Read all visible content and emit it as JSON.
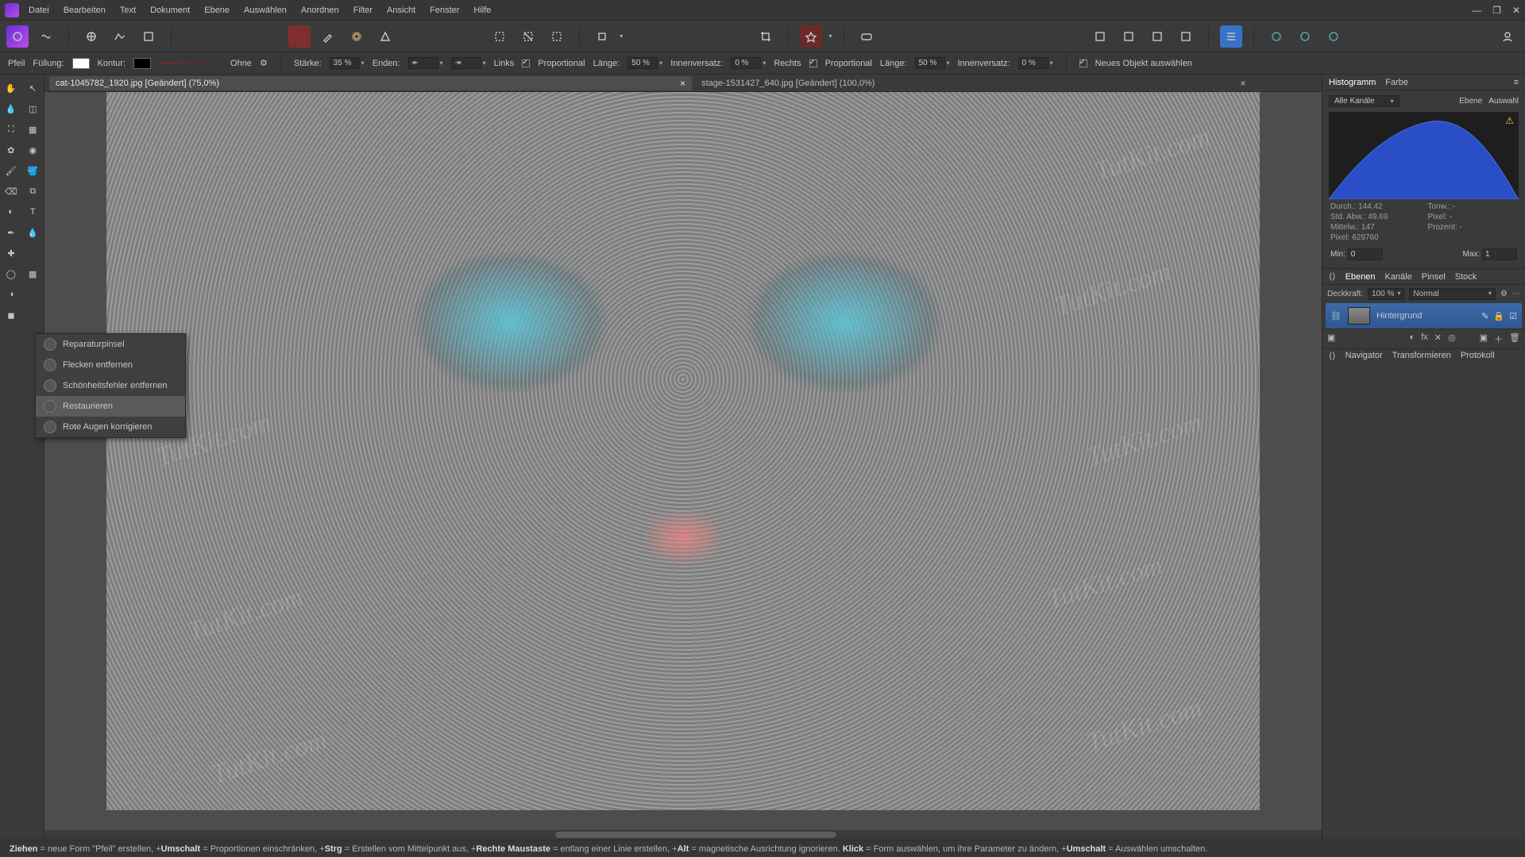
{
  "menubar": [
    "Datei",
    "Bearbeiten",
    "Text",
    "Dokument",
    "Ebene",
    "Auswählen",
    "Anordnen",
    "Filter",
    "Ansicht",
    "Fenster",
    "Hilfe"
  ],
  "context": {
    "tool": "Pfeil",
    "fill": "Füllung:",
    "stroke_label": "Kontur:",
    "style_label": "Ohne",
    "strength_label": "Stärke:",
    "strength": "35 %",
    "ends_label": "Enden:",
    "links_label": "Links",
    "proportional": "Proportional",
    "length_label": "Länge:",
    "length_l": "50 %",
    "inset_label": "Innenversatz:",
    "inset_l": "0 %",
    "rechts_label": "Rechts",
    "length_r": "50 %",
    "inset_r": "0 %",
    "new_obj": "Neues Objekt auswählen"
  },
  "tabs": [
    {
      "title": "cat-1045782_1920.jpg [Geändert] (75,0%)",
      "active": true
    },
    {
      "title": "stage-1531427_640.jpg [Geändert] (100,0%)",
      "active": false
    }
  ],
  "flyout": {
    "items": [
      {
        "label": "Reparaturpinsel"
      },
      {
        "label": "Flecken entfernen"
      },
      {
        "label": "Schönheitsfehler entfernen"
      },
      {
        "label": "Restaurieren",
        "hl": true
      },
      {
        "label": "Rote Augen korrigieren"
      }
    ]
  },
  "watermark": "TutKit.com",
  "right": {
    "tabs1": [
      "Histogramm",
      "Farbe"
    ],
    "channel_label": "Alle Kanäle",
    "ebene": "Ebene",
    "auswahl": "Auswahl",
    "stats": {
      "durch": "Durch.: 144.42",
      "stdabw": "Std. Abw.: 49.69",
      "mittelw": "Mittelw.: 147",
      "pixel": "Pixel: 629760",
      "tonw": "Tonw.: -",
      "pixel2": "Pixel: -",
      "prozent": "Prozent: -"
    },
    "min_label": "Min:",
    "min": "0",
    "max_label": "Max:",
    "max": "1",
    "tabs2": [
      "Ebenen",
      "Kanäle",
      "Pinsel",
      "Stock"
    ],
    "opacity_label": "Deckkraft:",
    "opacity": "100 %",
    "blend": "Normal",
    "layer_name": "Hintergrund",
    "tabs3": [
      "Navigator",
      "Transformieren",
      "Protokoll"
    ]
  },
  "status": {
    "parts": [
      {
        "b": "Ziehen",
        "t": " = neue Form \"Pfeil\" erstellen, +"
      },
      {
        "b": "Umschalt",
        "t": " = Proportionen einschränken, +"
      },
      {
        "b": "Strg",
        "t": " = Erstellen vom Mittelpunkt aus, +"
      },
      {
        "b": "Rechte Maustaste",
        "t": " = entlang einer Linie erstellen, +"
      },
      {
        "b": "Alt",
        "t": " = magnetische Ausrichtung ignorieren. "
      },
      {
        "b": "Klick",
        "t": " = Form auswählen, um ihre Parameter zu ändern, +"
      },
      {
        "b": "Umschalt",
        "t": " = Auswählen umschalten."
      }
    ]
  }
}
